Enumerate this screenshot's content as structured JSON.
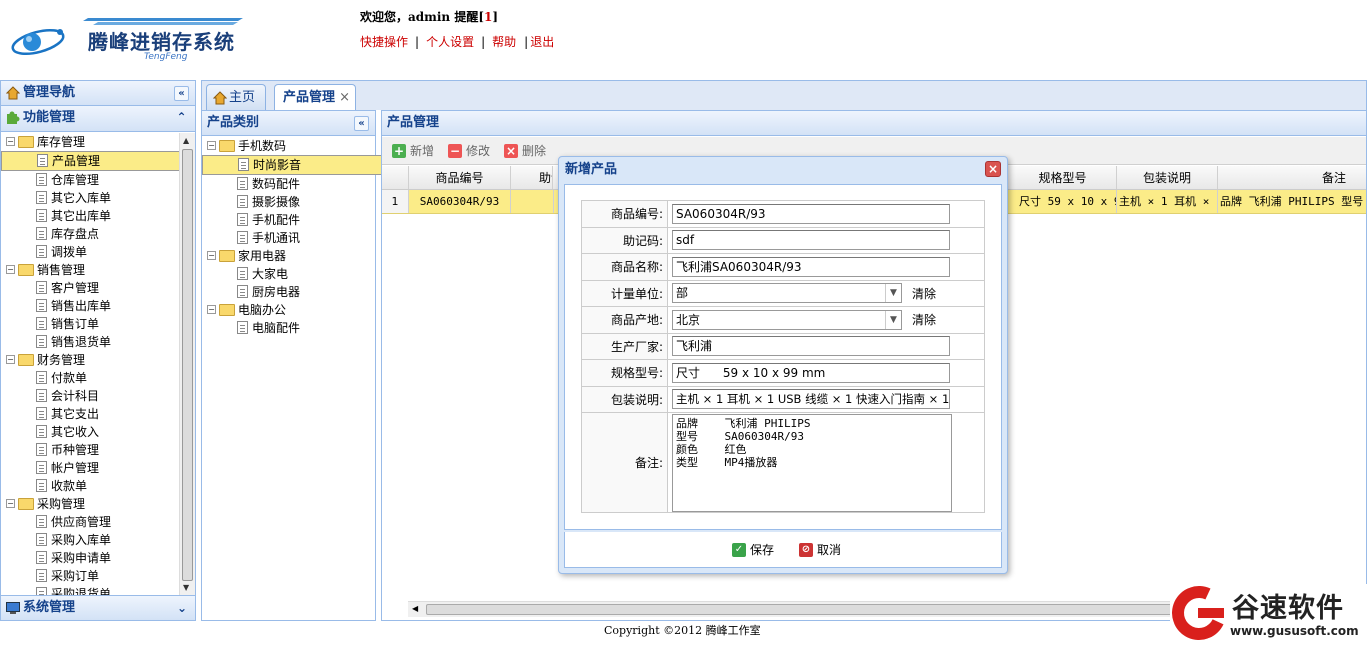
{
  "header": {
    "app_title": "腾峰进销存系统",
    "app_subtitle": "TengFeng",
    "welcome_prefix": "欢迎您，admin  提醒[",
    "reminder_count": "1",
    "welcome_suffix": "]",
    "links": [
      "快捷操作",
      "个人设置",
      "帮助",
      "退出"
    ]
  },
  "leftnav": {
    "title": "管理导航",
    "section_title": "功能管理",
    "tree": [
      {
        "label": "库存管理",
        "type": "folder"
      },
      {
        "label": "产品管理",
        "type": "leaf",
        "selected": true
      },
      {
        "label": "仓库管理",
        "type": "leaf"
      },
      {
        "label": "其它入库单",
        "type": "leaf"
      },
      {
        "label": "其它出库单",
        "type": "leaf"
      },
      {
        "label": "库存盘点",
        "type": "leaf"
      },
      {
        "label": "调拨单",
        "type": "leaf"
      },
      {
        "label": "销售管理",
        "type": "folder"
      },
      {
        "label": "客户管理",
        "type": "leaf"
      },
      {
        "label": "销售出库单",
        "type": "leaf"
      },
      {
        "label": "销售订单",
        "type": "leaf"
      },
      {
        "label": "销售退货单",
        "type": "leaf"
      },
      {
        "label": "财务管理",
        "type": "folder"
      },
      {
        "label": "付款单",
        "type": "leaf"
      },
      {
        "label": "会计科目",
        "type": "leaf"
      },
      {
        "label": "其它支出",
        "type": "leaf"
      },
      {
        "label": "其它收入",
        "type": "leaf"
      },
      {
        "label": "币种管理",
        "type": "leaf"
      },
      {
        "label": "帐户管理",
        "type": "leaf"
      },
      {
        "label": "收款单",
        "type": "leaf"
      },
      {
        "label": "采购管理",
        "type": "folder"
      },
      {
        "label": "供应商管理",
        "type": "leaf"
      },
      {
        "label": "采购入库单",
        "type": "leaf"
      },
      {
        "label": "采购申请单",
        "type": "leaf"
      },
      {
        "label": "采购订单",
        "type": "leaf"
      },
      {
        "label": "采购退货单",
        "type": "leaf"
      }
    ],
    "bottom_section": "系统管理"
  },
  "tabs": [
    "主页",
    "产品管理"
  ],
  "category_panel": {
    "title": "产品类别",
    "tree": [
      {
        "label": "手机数码",
        "type": "folder"
      },
      {
        "label": "时尚影音",
        "type": "leaf",
        "selected": true
      },
      {
        "label": "数码配件",
        "type": "leaf"
      },
      {
        "label": "摄影摄像",
        "type": "leaf"
      },
      {
        "label": "手机配件",
        "type": "leaf"
      },
      {
        "label": "手机通讯",
        "type": "leaf"
      },
      {
        "label": "家用电器",
        "type": "folder"
      },
      {
        "label": "大家电",
        "type": "leaf"
      },
      {
        "label": "厨房电器",
        "type": "leaf"
      },
      {
        "label": "电脑办公",
        "type": "folder"
      },
      {
        "label": "电脑配件",
        "type": "leaf"
      }
    ]
  },
  "product_panel": {
    "title": "产品管理",
    "toolbar": {
      "add": "新增",
      "edit": "修改",
      "delete": "删除"
    },
    "columns": [
      "商品编号",
      "助记",
      "规格型号",
      "包装说明",
      "备注"
    ],
    "rows": [
      {
        "index": "1",
        "code": "SA060304R/93",
        "mnemonic": "s",
        "spec": "尺寸 59 x 10 x 9",
        "package": "主机 × 1 耳机 × ",
        "remark": "品牌 飞利浦 PHILIPS 型号"
      }
    ]
  },
  "dialog": {
    "title": "新增产品",
    "fields": {
      "code_label": "商品编号:",
      "code": "SA060304R/93",
      "mnemonic_label": "助记码:",
      "mnemonic": "sdf",
      "name_label": "商品名称:",
      "name": "飞利浦SA060304R/93",
      "unit_label": "计量单位:",
      "unit": "部",
      "origin_label": "商品产地:",
      "origin": "北京",
      "maker_label": "生产厂家:",
      "maker": "飞利浦",
      "spec_label": "规格型号:",
      "spec": "尺寸      59 x 10 x 99 mm",
      "package_label": "包装说明:",
      "package": "主机 × 1 耳机 × 1 USB 线缆 × 1 快速入门指南 × 1",
      "remark_label": "备注:",
      "remark": "品牌    飞利浦 PHILIPS\n型号    SA060304R/93\n颜色    红色\n类型    MP4播放器"
    },
    "clear_label": "清除",
    "save": "保存",
    "cancel": "取消"
  },
  "footer": "Copyright ©2012 腾峰工作室",
  "watermark": {
    "text": "谷速软件",
    "url": "www.gususoft.com"
  },
  "colors": {
    "accent": "#15428b",
    "panel_border": "#99bbe8",
    "selected_row": "#fbec88",
    "link_red": "#cc0000"
  }
}
